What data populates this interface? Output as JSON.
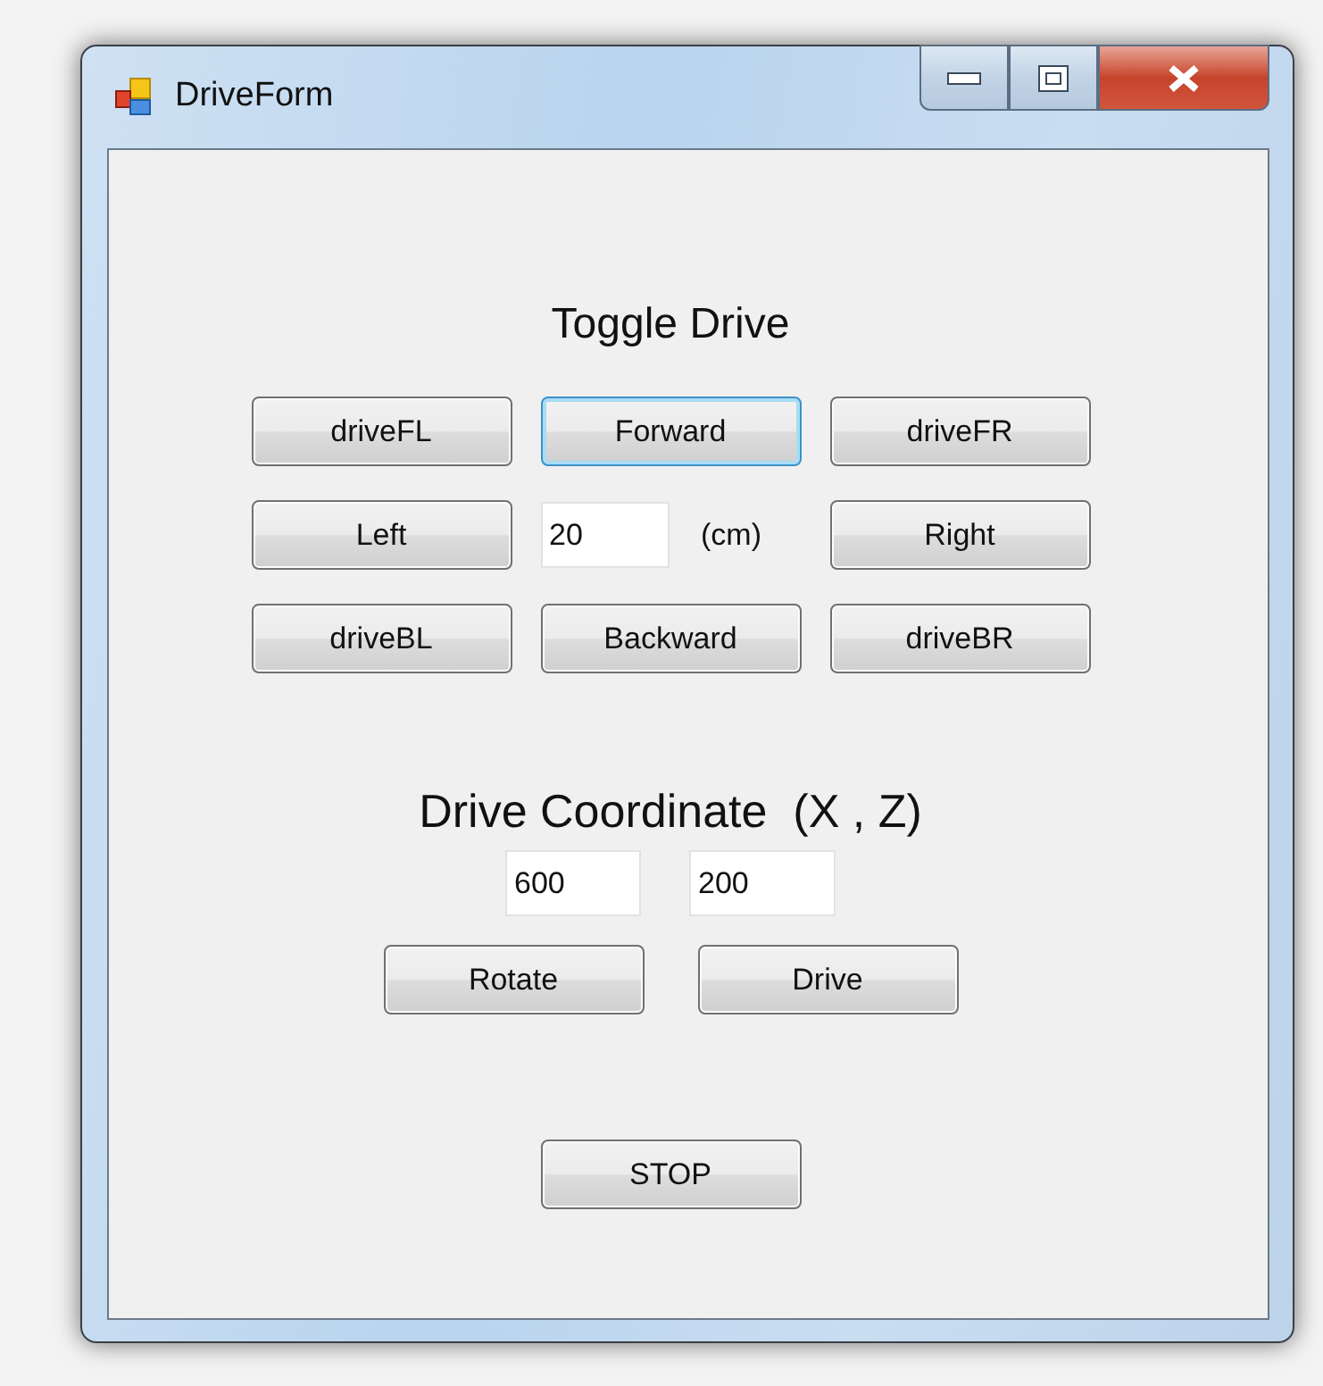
{
  "window": {
    "title": "DriveForm"
  },
  "toggle_drive": {
    "heading": "Toggle Drive",
    "grid": [
      {
        "kind": "button",
        "label": "driveFL",
        "focused": false
      },
      {
        "kind": "button",
        "label": "Forward",
        "focused": true
      },
      {
        "kind": "button",
        "label": "driveFR",
        "focused": false
      },
      {
        "kind": "button",
        "label": "Left",
        "focused": false
      },
      {
        "kind": "field_with_unit",
        "value": "20",
        "unit": "(cm)"
      },
      {
        "kind": "button",
        "label": "Right",
        "focused": false
      },
      {
        "kind": "button",
        "label": "driveBL",
        "focused": false
      },
      {
        "kind": "button",
        "label": "Backward",
        "focused": false
      },
      {
        "kind": "button",
        "label": "driveBR",
        "focused": false
      }
    ]
  },
  "drive_coordinate": {
    "heading": "Drive Coordinate  (X , Z)",
    "fields": [
      {
        "value": "600"
      },
      {
        "value": "200"
      }
    ],
    "buttons": [
      {
        "label": "Rotate",
        "focused": false
      },
      {
        "label": "Drive",
        "focused": false
      }
    ]
  },
  "stop_button": {
    "label": "STOP",
    "focused": false
  }
}
